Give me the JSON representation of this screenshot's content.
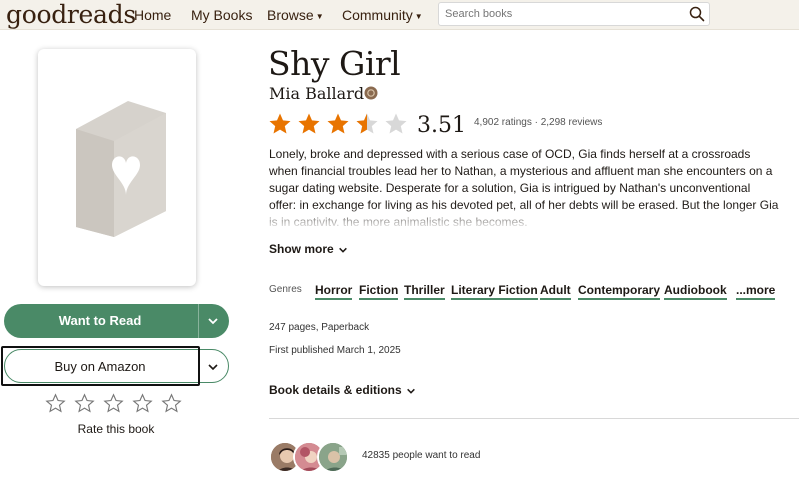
{
  "header": {
    "logo": "goodreads",
    "nav": [
      {
        "label": "Home",
        "has_caret": false
      },
      {
        "label": "My Books",
        "has_caret": false
      },
      {
        "label": "Browse",
        "has_caret": true
      },
      {
        "label": "Community",
        "has_caret": true
      }
    ],
    "search": {
      "placeholder": "Search books",
      "icon": "search-icon"
    }
  },
  "book": {
    "title": "Shy Girl",
    "author": "Mia Ballard",
    "rating": {
      "average": "3.51",
      "stars_filled": 3.5,
      "stars_total": 5,
      "counts_text": "4,902 ratings · 2,298 reviews"
    },
    "description": "Lonely, broke and depressed with a serious case of OCD, Gia finds herself at a crossroads when financial troubles lead her to Nathan, a mysterious and affluent man she encounters on a sugar dating website. Desperate for a solution, Gia is intrigued by Nathan's unconventional offer: in exchange for living as his devoted pet, all of her debts will be erased. But the longer Gia is in captivity, the more animalistic she becomes.",
    "show_more": "Show more",
    "genres_label": "Genres",
    "genres": [
      "Horror",
      "Fiction",
      "Thriller",
      "Literary Fiction",
      "Adult",
      "Contemporary",
      "Audiobook"
    ],
    "genres_more": "...more",
    "pages": "247 pages, Paperback",
    "first_published": "First published March 1, 2025",
    "details_link": "Book details & editions",
    "want_to_read_count": "42835 people want to read"
  },
  "actions": {
    "want_to_read": "Want to Read",
    "buy": "Buy on Amazon",
    "rate_label": "Rate this book"
  },
  "colors": {
    "header_bg": "#f4f1ea",
    "brand_brown": "#382110",
    "accent_green": "#4a8a67",
    "star_orange": "#e87400"
  }
}
